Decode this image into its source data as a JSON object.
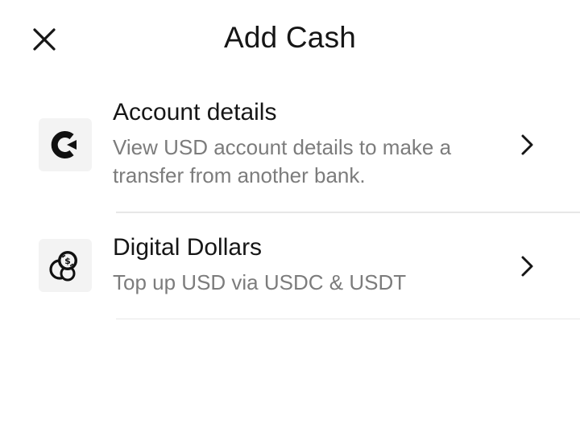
{
  "header": {
    "title": "Add Cash",
    "close_icon": "close-icon"
  },
  "options": [
    {
      "title": "Account details",
      "description": "View USD account details to make a transfer from another bank.",
      "icon": "bank-logo-icon",
      "trailing_icon": "chevron-right-icon"
    },
    {
      "title": "Digital Dollars",
      "description": "Top up USD via USDC & USDT",
      "icon": "coins-icon",
      "trailing_icon": "chevron-right-icon"
    }
  ],
  "colors": {
    "title_text": "#161616",
    "secondary_text": "#7c7c7c",
    "icon_bg": "#f3f3f3",
    "divider": "#e7e7e7"
  }
}
